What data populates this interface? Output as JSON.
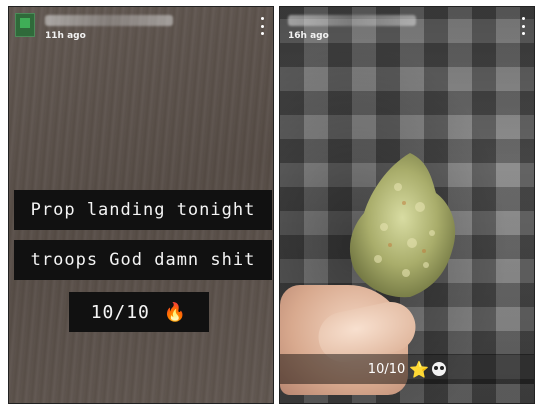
{
  "left_story": {
    "time_ago": "11h ago",
    "captions": [
      "Prop landing tonight",
      "troops God damn shit",
      "10/10"
    ],
    "caption_emoji": "🔥",
    "icons": {
      "more": "more-vertical-icon",
      "avatar": "avatar"
    }
  },
  "right_story": {
    "time_ago": "16h ago",
    "caption": "10/10",
    "caption_emojis": [
      "⭐",
      "dizzy-face"
    ],
    "icons": {
      "more": "more-vertical-icon"
    }
  },
  "colors": {
    "caption_bg": "#111111",
    "caption_text": "#f4f4f4",
    "star": "#f7c829"
  }
}
